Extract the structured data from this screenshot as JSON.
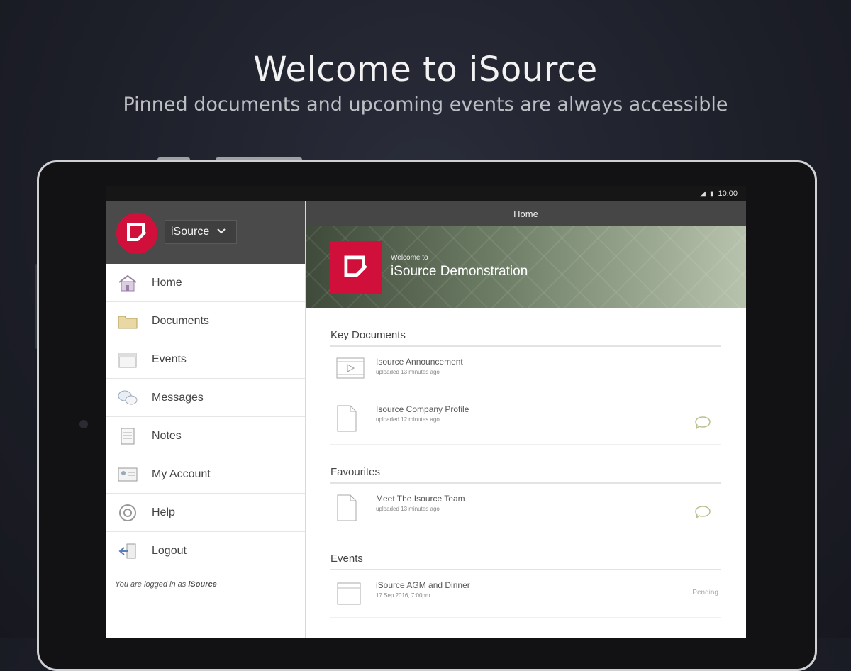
{
  "promo": {
    "title": "Welcome to iSource",
    "subtitle": "Pinned documents and upcoming events are always accessible"
  },
  "status_bar": {
    "time": "10:00"
  },
  "sidebar": {
    "org_selector": "iSource",
    "items": [
      {
        "label": "Home",
        "icon": "home-icon"
      },
      {
        "label": "Documents",
        "icon": "folder-icon"
      },
      {
        "label": "Events",
        "icon": "calendar-icon"
      },
      {
        "label": "Messages",
        "icon": "chat-bubbles-icon"
      },
      {
        "label": "Notes",
        "icon": "notes-icon"
      },
      {
        "label": "My Account",
        "icon": "account-card-icon"
      },
      {
        "label": "Help",
        "icon": "lifebuoy-icon"
      },
      {
        "label": "Logout",
        "icon": "logout-icon"
      }
    ],
    "logged_in_prefix": "You are logged in as",
    "logged_in_user": "iSource"
  },
  "main": {
    "topbar_title": "Home",
    "banner": {
      "welcome": "Welcome to",
      "org_name": "iSource Demonstration"
    },
    "key_documents": {
      "title": "Key Documents",
      "items": [
        {
          "title": "Isource Announcement",
          "meta": "uploaded 13 minutes ago",
          "icon": "video-icon"
        },
        {
          "title": "Isource Company Profile",
          "meta": "uploaded 12 minutes ago",
          "icon": "document-icon"
        }
      ]
    },
    "favourites": {
      "title": "Favourites",
      "items": [
        {
          "title": "Meet The Isource Team",
          "meta": "uploaded 13 minutes ago",
          "icon": "document-icon"
        }
      ]
    },
    "events": {
      "title": "Events",
      "items": [
        {
          "title": "iSource AGM and Dinner",
          "meta": "17 Sep 2016, 7:00pm",
          "status": "Pending"
        }
      ]
    }
  },
  "colors": {
    "brand_red": "#d0103a",
    "header_gray": "#4a4a4a"
  }
}
